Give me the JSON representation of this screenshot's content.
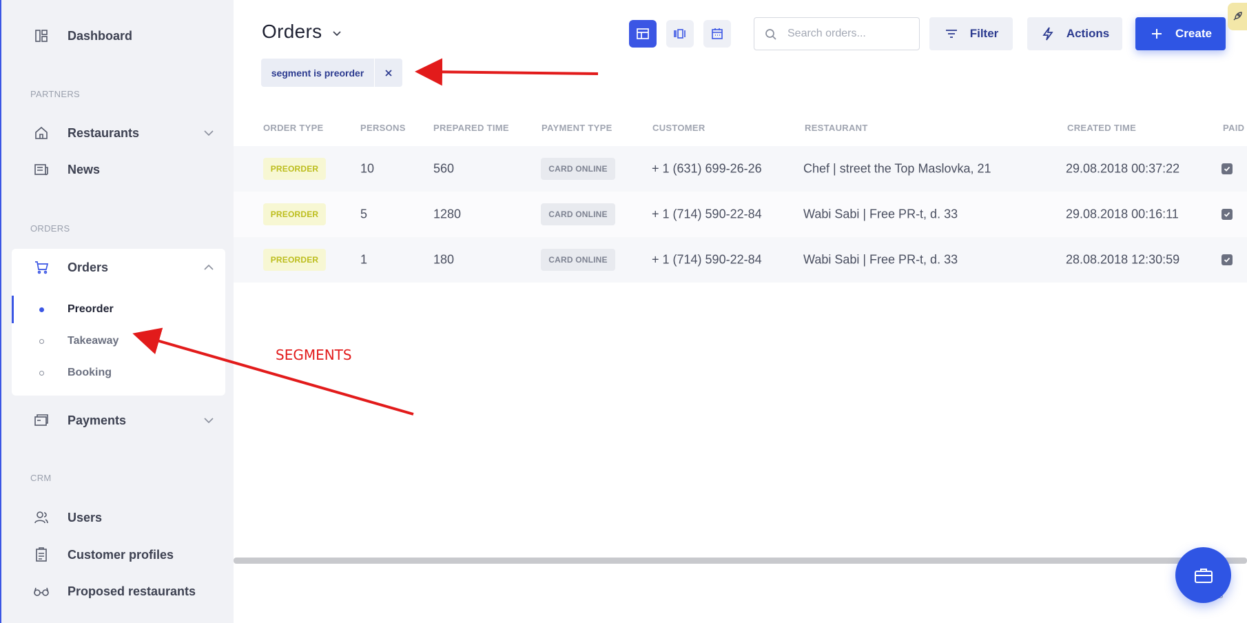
{
  "sidebar": {
    "dashboard": "Dashboard",
    "sections": {
      "partners": "PARTNERS",
      "orders": "ORDERS",
      "crm": "CRM"
    },
    "partners": [
      {
        "label": "Restaurants"
      },
      {
        "label": "News"
      }
    ],
    "orders_group": {
      "label": "Orders",
      "segments": [
        {
          "label": "Preorder",
          "active": true
        },
        {
          "label": "Takeaway",
          "active": false
        },
        {
          "label": "Booking",
          "active": false
        }
      ]
    },
    "payments": "Payments",
    "crm": [
      {
        "label": "Users"
      },
      {
        "label": "Customer profiles"
      },
      {
        "label": "Proposed restaurants"
      }
    ]
  },
  "header": {
    "title": "Orders",
    "search_placeholder": "Search orders...",
    "filter_label": "Filter",
    "actions_label": "Actions",
    "create_label": "Create"
  },
  "active_filter": {
    "text": "segment is preorder"
  },
  "table": {
    "columns": [
      "ORDER TYPE",
      "PERSONS",
      "PREPARED TIME",
      "PAYMENT TYPE",
      "CUSTOMER",
      "RESTAURANT",
      "CREATED TIME",
      "PAID"
    ],
    "rows": [
      {
        "order_type": "PREORDER",
        "persons": "10",
        "prepared_time": "560",
        "payment_type": "CARD ONLINE",
        "customer": "+ 1 (631) 699-26-26",
        "restaurant": "Chef | street the Top Maslovka, 21",
        "created_time": "29.08.2018 00:37:22",
        "paid": true
      },
      {
        "order_type": "PREORDER",
        "persons": "5",
        "prepared_time": "1280",
        "payment_type": "CARD ONLINE",
        "customer": "+ 1 (714) 590-22-84",
        "restaurant": "Wabi Sabi | Free PR-t, d. 33",
        "created_time": "29.08.2018 00:16:11",
        "paid": true
      },
      {
        "order_type": "PREORDER",
        "persons": "1",
        "prepared_time": "180",
        "payment_type": "CARD ONLINE",
        "customer": "+ 1 (714) 590-22-84",
        "restaurant": "Wabi Sabi | Free PR-t, d. 33",
        "created_time": "28.08.2018 12:30:59",
        "paid": true
      }
    ]
  },
  "footer_ghost_text": "ers",
  "annotation": {
    "label": "SEGMENTS",
    "color": "#e21b1b"
  },
  "colors": {
    "accent": "#2f55e4",
    "badge_preorder": "#bcbd1c",
    "sidebar_bg": "#f1f2f6"
  }
}
